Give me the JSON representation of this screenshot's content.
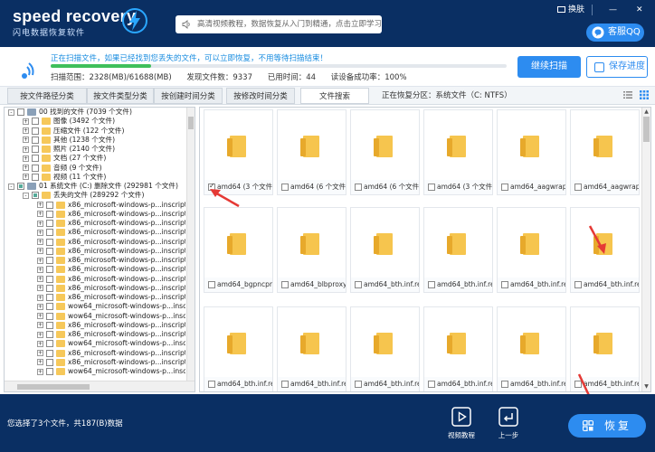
{
  "app": {
    "logo_text": "speed recovery",
    "logo_subtitle": "闪电数据恢复软件"
  },
  "top_bar": {
    "notice": "高清视频教程，数据恢复从入门到精通，点击立即学习！",
    "skin_label": "换肤",
    "minimize": "—",
    "close": "✕",
    "qq_service": "客服QQ"
  },
  "scan_status": {
    "message": "正在扫描文件，如果已经找到您丢失的文件，可以立即恢复，不用等待扫描结束！",
    "progress_fraction": 0.22,
    "scan_range": "扫描范围：2328(MB)/61688(MB)",
    "files_found": "发现文件数：9337",
    "elapsed": "已用时间：44",
    "read_success": "读设备成功率：100%",
    "continue_button": "继续扫描",
    "save_button": "保存进度"
  },
  "tabs": [
    {
      "label": "按文件路径分类",
      "active": false
    },
    {
      "label": "按文件类型分类",
      "active": false
    },
    {
      "label": "按创建时间分类",
      "active": false
    },
    {
      "label": "按修改时间分类",
      "active": false
    },
    {
      "label": "文件搜索",
      "active": true
    }
  ],
  "current_partition": "正在恢复分区：系统文件（C: NTFS）",
  "tree": [
    {
      "label": "00 找到的文件  (7039 个文件)",
      "level": 0,
      "expand": "-",
      "check": "off",
      "icon": "drive"
    },
    {
      "label": "图像      (3492 个文件)",
      "level": 1,
      "expand": "+",
      "check": "off",
      "icon": "folder"
    },
    {
      "label": "压缩文件    (122 个文件)",
      "level": 1,
      "expand": "+",
      "check": "off",
      "icon": "folder"
    },
    {
      "label": "其他      (1238 个文件)",
      "level": 1,
      "expand": "+",
      "check": "off",
      "icon": "folder"
    },
    {
      "label": "照片      (2140 个文件)",
      "level": 1,
      "expand": "+",
      "check": "off",
      "icon": "folder"
    },
    {
      "label": "文档      (27 个文件)",
      "level": 1,
      "expand": "+",
      "check": "off",
      "icon": "folder"
    },
    {
      "label": "音频      (9 个文件)",
      "level": 1,
      "expand": "+",
      "check": "off",
      "icon": "folder"
    },
    {
      "label": "视频      (11 个文件)",
      "level": 1,
      "expand": "+",
      "check": "off",
      "icon": "folder"
    },
    {
      "label": "01 系统文件 (C:) 删除文件  (292981 个文件)",
      "level": 0,
      "expand": "-",
      "check": "part",
      "icon": "drive"
    },
    {
      "label": "丢失的文件    (289292 个文件)",
      "level": 1,
      "expand": "-",
      "check": "part",
      "icon": "folder"
    },
    {
      "label": "x86_microsoft-windows-p...inscripts.resourc",
      "level": 2,
      "expand": "+",
      "check": "off",
      "icon": "folder"
    },
    {
      "label": "x86_microsoft-windows-p...inscripts.resourc",
      "level": 2,
      "expand": "+",
      "check": "off",
      "icon": "folder"
    },
    {
      "label": "x86_microsoft-windows-p...inscripts.resourc",
      "level": 2,
      "expand": "+",
      "check": "off",
      "icon": "folder"
    },
    {
      "label": "x86_microsoft-windows-p...inscripts.resourc",
      "level": 2,
      "expand": "+",
      "check": "off",
      "icon": "folder"
    },
    {
      "label": "x86_microsoft-windows-p...inscripts.resourc",
      "level": 2,
      "expand": "+",
      "check": "off",
      "icon": "folder"
    },
    {
      "label": "x86_microsoft-windows-p...inscripts.resourc",
      "level": 2,
      "expand": "+",
      "check": "off",
      "icon": "folder"
    },
    {
      "label": "x86_microsoft-windows-p...inscripts.resourc",
      "level": 2,
      "expand": "+",
      "check": "off",
      "icon": "folder"
    },
    {
      "label": "x86_microsoft-windows-p...inscripts.resourc",
      "level": 2,
      "expand": "+",
      "check": "off",
      "icon": "folder"
    },
    {
      "label": "x86_microsoft-windows-p...inscripts.resourc",
      "level": 2,
      "expand": "+",
      "check": "off",
      "icon": "folder"
    },
    {
      "label": "x86_microsoft-windows-p...inscripts.resourc",
      "level": 2,
      "expand": "+",
      "check": "off",
      "icon": "folder"
    },
    {
      "label": "x86_microsoft-windows-p...inscripts.resourc",
      "level": 2,
      "expand": "+",
      "check": "off",
      "icon": "folder"
    },
    {
      "label": "wow64_microsoft-windows-p...inscripts.reso",
      "level": 2,
      "expand": "+",
      "check": "off",
      "icon": "folder"
    },
    {
      "label": "wow64_microsoft-windows-p...inscripts.reso",
      "level": 2,
      "expand": "+",
      "check": "off",
      "icon": "folder"
    },
    {
      "label": "x86_microsoft-windows-p...inscripts.resourc",
      "level": 2,
      "expand": "+",
      "check": "off",
      "icon": "folder"
    },
    {
      "label": "x86_microsoft-windows-p...inscripts.resourc",
      "level": 2,
      "expand": "+",
      "check": "off",
      "icon": "folder"
    },
    {
      "label": "wow64_microsoft-windows-p...inscripts.reso",
      "level": 2,
      "expand": "+",
      "check": "off",
      "icon": "folder"
    },
    {
      "label": "x86_microsoft-windows-p...inscripts.resourc",
      "level": 2,
      "expand": "+",
      "check": "off",
      "icon": "folder"
    },
    {
      "label": "x86_microsoft-windows-p...inscripts.resourc",
      "level": 2,
      "expand": "+",
      "check": "off",
      "icon": "folder"
    },
    {
      "label": "wow64_microsoft-windows-p...inscripts.reso",
      "level": 2,
      "expand": "+",
      "check": "off",
      "icon": "folder"
    }
  ],
  "files": [
    {
      "name": "amd64 (3 个文件)",
      "checked": true
    },
    {
      "name": "amd64 (6 个文件)",
      "checked": false
    },
    {
      "name": "amd64 (6 个文件)",
      "checked": false
    },
    {
      "name": "amd64 (3 个文件)",
      "checked": false
    },
    {
      "name": "amd64_aagwrapp...",
      "checked": false
    },
    {
      "name": "amd64_aagwrapp...",
      "checked": false
    },
    {
      "name": "amd64_bgpncpro...",
      "checked": false
    },
    {
      "name": "amd64_blbproxy_...",
      "checked": false
    },
    {
      "name": "amd64_bth.inf.re...",
      "checked": false
    },
    {
      "name": "amd64_bth.inf.re...",
      "checked": false
    },
    {
      "name": "amd64_bth.inf.re...",
      "checked": false
    },
    {
      "name": "amd64_bth.inf.re...",
      "checked": false
    },
    {
      "name": "amd64_bth.inf.re...",
      "checked": false
    },
    {
      "name": "amd64_bth.inf.re...",
      "checked": false
    },
    {
      "name": "amd64_bth.inf.re...",
      "checked": false
    },
    {
      "name": "amd64_bth.inf.re...",
      "checked": false
    },
    {
      "name": "amd64_bth.inf.re...",
      "checked": false
    },
    {
      "name": "amd64_bth.inf.re...",
      "checked": false
    }
  ],
  "footer": {
    "selection": "您选择了3个文件，共187(B)数据",
    "video_tutorial": "视频教程",
    "previous_step": "上一步",
    "recover": "恢复"
  },
  "colors": {
    "header_bg": "#0a2f63",
    "accent": "#2d8cf0",
    "progress": "#3fbf5b",
    "annotation_arrow": "#e53935"
  }
}
